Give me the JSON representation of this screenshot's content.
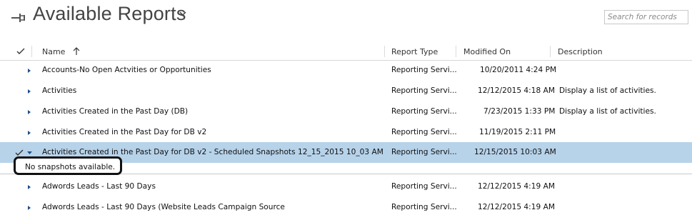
{
  "header": {
    "title": "Available Reports",
    "search_placeholder": "Search for records"
  },
  "columns": {
    "name": "Name",
    "report_type": "Report Type",
    "modified_on": "Modified On",
    "description": "Description"
  },
  "rows": [
    {
      "name": "Accounts-No Open Actvities or Opportunities",
      "type": "Reporting Servi...",
      "modified": "10/20/2011 4:24 PM",
      "description": ""
    },
    {
      "name": "Activities",
      "type": "Reporting Servi...",
      "modified": "12/12/2015 4:18 AM",
      "description": "Display a list of activities."
    },
    {
      "name": "Activities Created in the Past Day (DB)",
      "type": "Reporting Servi...",
      "modified": "7/23/2015 1:33 PM",
      "description": "Display a list of activities."
    },
    {
      "name": "Activities Created in the Past Day for DB v2",
      "type": "Reporting Servi...",
      "modified": "11/19/2015 2:11 PM",
      "description": ""
    },
    {
      "name": "Activities Created in the Past Day for DB v2 - Scheduled Snapshots 12_15_2015 10_03 AM",
      "type": "Reporting Servi...",
      "modified": "12/15/2015 10:03 AM",
      "description": ""
    },
    {
      "name": "Adwords Leads - Last 90 Days",
      "type": "Reporting Servi...",
      "modified": "12/12/2015 4:19 AM",
      "description": ""
    },
    {
      "name": "Adwords Leads - Last 90 Days (Website Leads Campaign Source",
      "type": "Reporting Servi...",
      "modified": "12/12/2015 4:19 AM",
      "description": ""
    }
  ],
  "snapshot_message": "No snapshots available.",
  "colors": {
    "selected_row": "#b7d3ea",
    "expand_arrow": "#1f4e8c"
  }
}
